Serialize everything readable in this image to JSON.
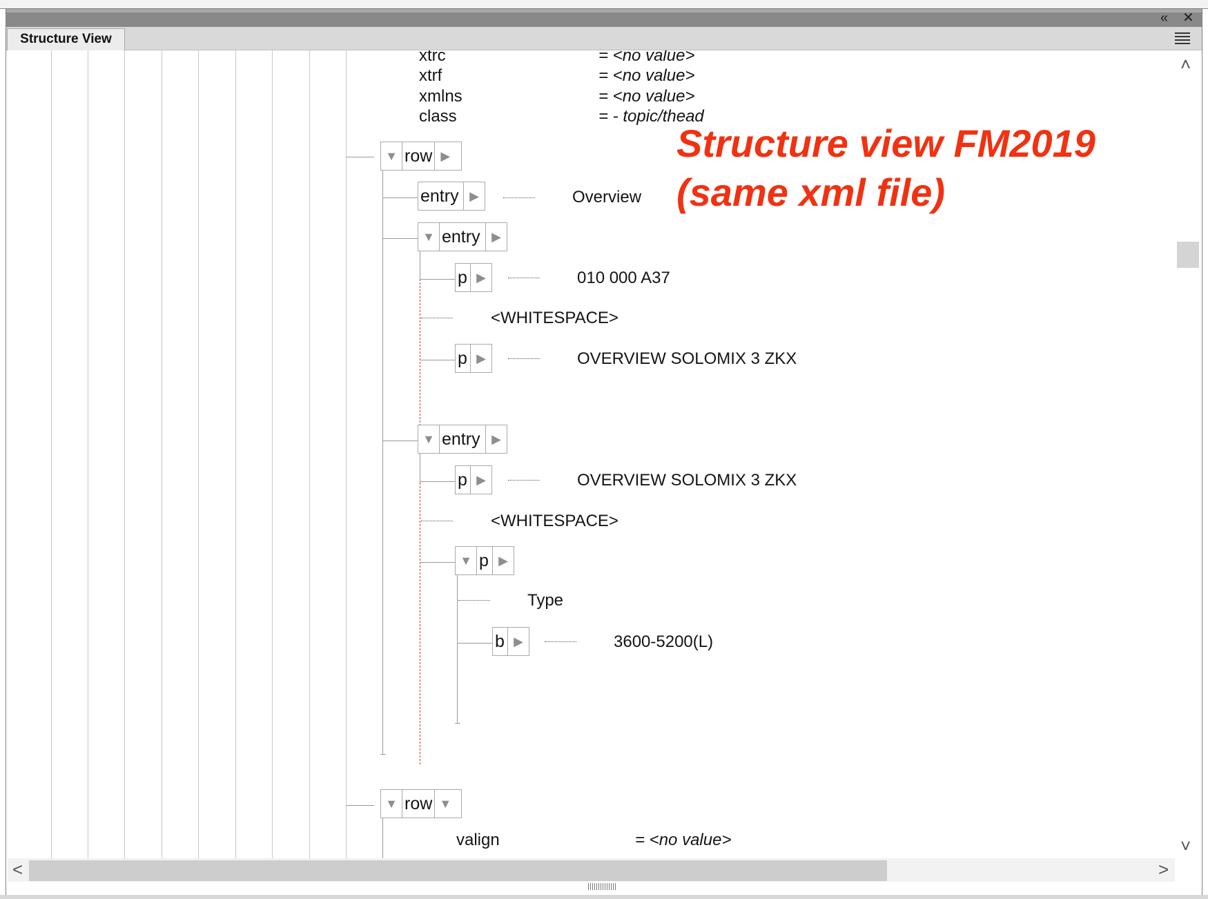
{
  "panel": {
    "title": "Structure View",
    "collapse_glyph": "«",
    "close_glyph": "✕",
    "menu_icon": "hamburger-icon"
  },
  "attributes": [
    {
      "name": "xtrc",
      "value": "= <no value>"
    },
    {
      "name": "xtrf",
      "value": "= <no value>"
    },
    {
      "name": "xmlns",
      "value": "= <no value>"
    },
    {
      "name": "class",
      "value": "= - topic/thead"
    }
  ],
  "tree": {
    "row1": {
      "label": "row"
    },
    "entry1": {
      "label": "entry",
      "content": "Overview"
    },
    "entry2": {
      "label": "entry"
    },
    "entry2_p1": {
      "label": "p",
      "content": "010 000 A37"
    },
    "entry2_ws": "<WHITESPACE>",
    "entry2_p2": {
      "label": "p",
      "content": "OVERVIEW SOLOMIX 3 ZKX"
    },
    "entry3": {
      "label": "entry"
    },
    "entry3_p1": {
      "label": "p",
      "content": "OVERVIEW SOLOMIX 3 ZKX"
    },
    "entry3_ws": "<WHITESPACE>",
    "entry3_p2": {
      "label": "p",
      "text": "Type"
    },
    "entry3_b": {
      "label": "b",
      "content": "3600-5200(L)"
    },
    "row2": {
      "label": "row"
    },
    "row2_attr": {
      "name": "valign",
      "value": "= <no value>"
    }
  },
  "annotation": {
    "line1": "Structure view FM2019",
    "line2": "(same xml file)",
    "color": "#f03212"
  },
  "scroll": {
    "up_glyph": "˄",
    "down_glyph": "˅",
    "left_glyph": "<",
    "right_glyph": ">"
  }
}
